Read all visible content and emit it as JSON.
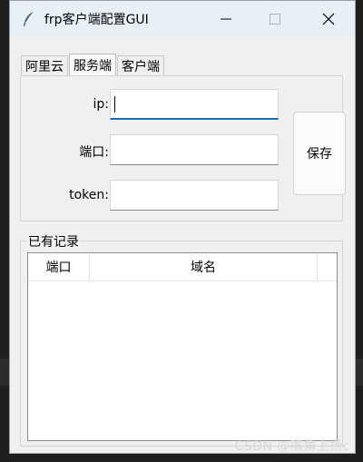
{
  "window": {
    "title": "frp客户端配置GUI"
  },
  "tabs": [
    {
      "label": "阿里云"
    },
    {
      "label": "服务端"
    },
    {
      "label": "客户端"
    }
  ],
  "form": {
    "ip_label": "ip:",
    "ip_value": "",
    "port_label": "端口:",
    "port_value": "",
    "token_label": "token:",
    "token_value": "",
    "save_label": "保存"
  },
  "records": {
    "group_title": "已有记录",
    "columns": [
      "端口",
      "域名"
    ],
    "rows": []
  },
  "watermark": "CSDN @嘴角上扬c",
  "colors": {
    "accent": "#1f6fc1",
    "titlebar": "#e7f0f7",
    "window_bg": "#f0f0f0"
  }
}
